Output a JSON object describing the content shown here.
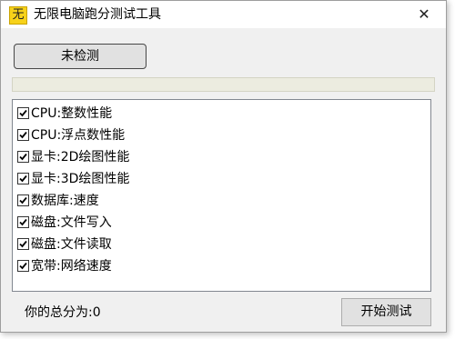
{
  "window": {
    "title": "无限电脑跑分测试工具",
    "icon_glyph": "无",
    "close_glyph": "✕"
  },
  "status_button": {
    "label": "未检测"
  },
  "progress": {
    "value_percent": 0
  },
  "tests": [
    {
      "label": "CPU:整数性能",
      "checked": true
    },
    {
      "label": "CPU:浮点数性能",
      "checked": true
    },
    {
      "label": "显卡:2D绘图性能",
      "checked": true
    },
    {
      "label": "显卡:3D绘图性能",
      "checked": true
    },
    {
      "label": "数据库:速度",
      "checked": true
    },
    {
      "label": "磁盘:文件写入",
      "checked": true
    },
    {
      "label": "磁盘:文件读取",
      "checked": true
    },
    {
      "label": "宽带:网络速度",
      "checked": true
    }
  ],
  "footer": {
    "score_text": "你的总分为:0",
    "start_button_label": "开始测试"
  },
  "colors": {
    "icon_bg": "#f7d21a",
    "progress_fill": "#06b025",
    "window_bg": "#f0f0f0"
  }
}
